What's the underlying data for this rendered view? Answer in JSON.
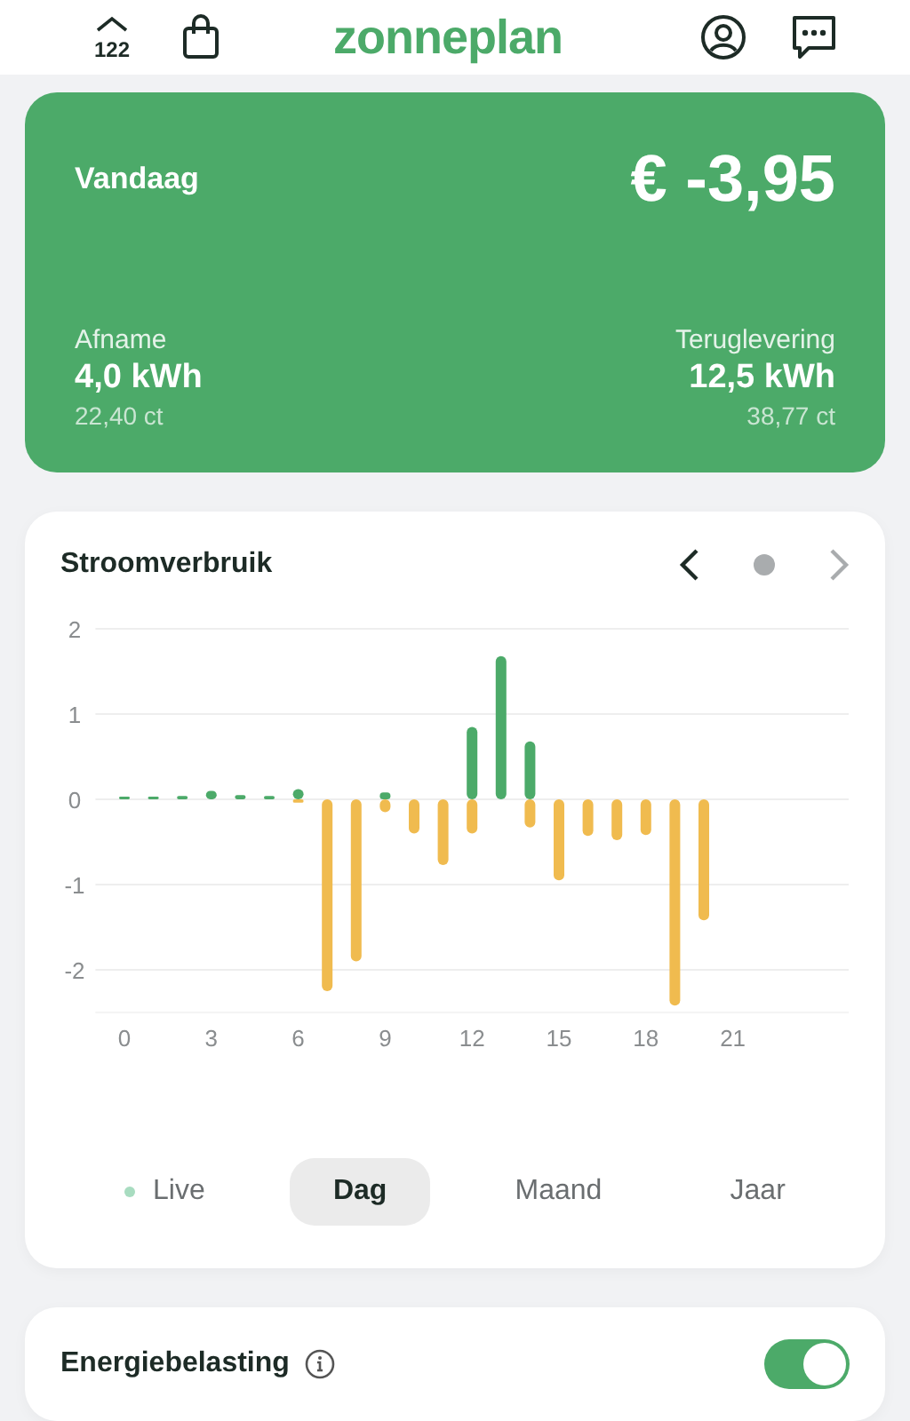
{
  "header": {
    "house_number": "122",
    "logo": "zonneplan"
  },
  "summary": {
    "title": "Vandaag",
    "amount": "€ -3,95",
    "left": {
      "label": "Afname",
      "value": "4,0 kWh",
      "sub": "22,40 ct"
    },
    "right": {
      "label": "Teruglevering",
      "value": "12,5 kWh",
      "sub": "38,77 ct"
    }
  },
  "usage": {
    "title": "Stroomverbruik",
    "chart_data": {
      "type": "bar",
      "grid": true,
      "xlim": [
        -1,
        25
      ],
      "ylim": [
        -2.5,
        2
      ],
      "x": [
        0,
        1,
        2,
        3,
        4,
        5,
        6,
        7,
        8,
        9,
        10,
        11,
        12,
        13,
        14,
        15,
        16,
        17,
        18,
        19,
        20
      ],
      "series": [
        {
          "color": "#4caa69",
          "values": [
            0.03,
            0.03,
            0.04,
            0.1,
            0.05,
            0.04,
            0.12,
            0,
            0,
            0.08,
            0,
            0,
            0.85,
            1.68,
            0.68,
            0,
            0,
            0,
            0,
            0,
            0
          ]
        },
        {
          "color": "#f0bb4f",
          "values": [
            0,
            0,
            0,
            0,
            0,
            0,
            -0.04,
            -2.25,
            -1.9,
            -0.15,
            -0.4,
            -0.77,
            -0.4,
            0,
            -0.33,
            -0.95,
            -0.43,
            -0.48,
            -0.42,
            -2.42,
            -1.42
          ]
        }
      ],
      "xticks": [
        0,
        3,
        6,
        9,
        12,
        15,
        18,
        21
      ],
      "yticks": [
        -2,
        -1,
        0,
        1,
        2
      ]
    },
    "periods": [
      {
        "label": "Live",
        "kind": "live",
        "selected": false
      },
      {
        "label": "Dag",
        "kind": "plain",
        "selected": true
      },
      {
        "label": "Maand",
        "kind": "plain",
        "selected": false
      },
      {
        "label": "Jaar",
        "kind": "plain",
        "selected": false
      }
    ]
  },
  "energy_tax": {
    "label": "Energiebelasting",
    "on": true
  }
}
